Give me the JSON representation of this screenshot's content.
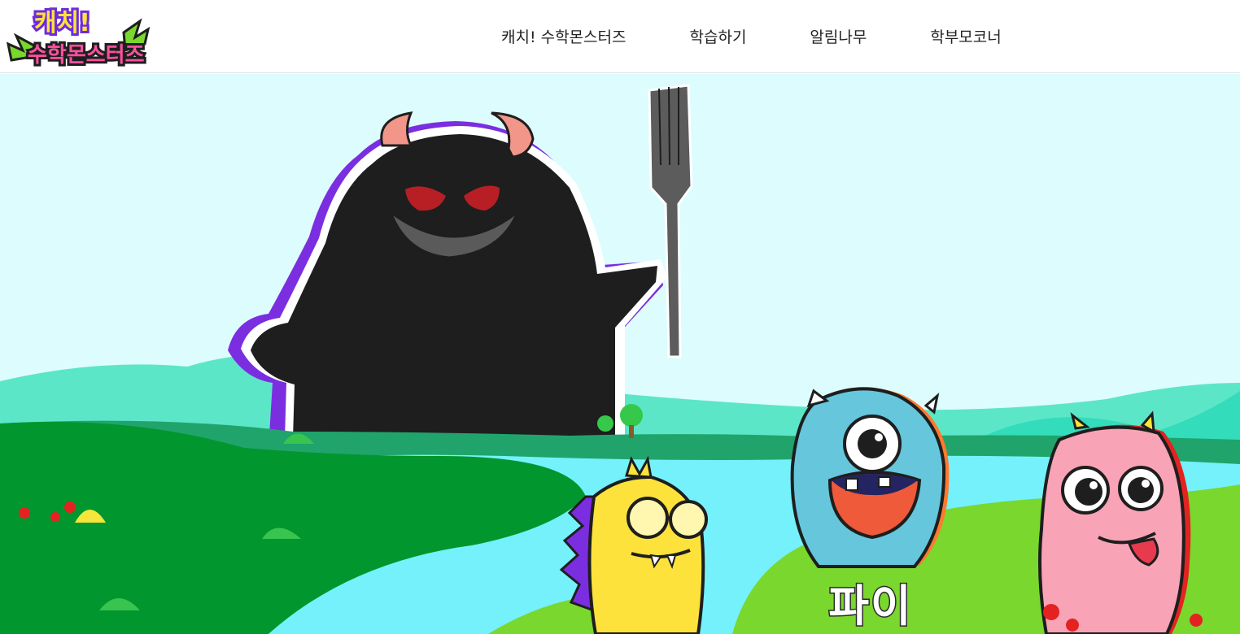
{
  "header": {
    "logo": {
      "line1": "캐치!",
      "line2": "수학몬스터즈",
      "icon": "catch-math-monsters-logo"
    },
    "nav": [
      {
        "label": "캐치! 수학몬스터즈"
      },
      {
        "label": "학습하기"
      },
      {
        "label": "알림나무"
      },
      {
        "label": "학부모코너"
      }
    ]
  },
  "hero": {
    "caption": "파이",
    "colors": {
      "sky": "#ddfcfd",
      "river": "#74f1fb",
      "grass_dark": "#02962e",
      "grass_light": "#7ad72d",
      "monster_black": "#1e1e1e",
      "monster_blue": "#65c6dc",
      "monster_pink": "#f9a3b6",
      "monster_yellow": "#fce23b",
      "accent_purple": "#7b2ee0"
    },
    "characters": [
      "black-monster-with-fork",
      "yellow-monster-with-glasses",
      "blue-one-eyed-monster",
      "pink-monster-tongue-out"
    ]
  }
}
